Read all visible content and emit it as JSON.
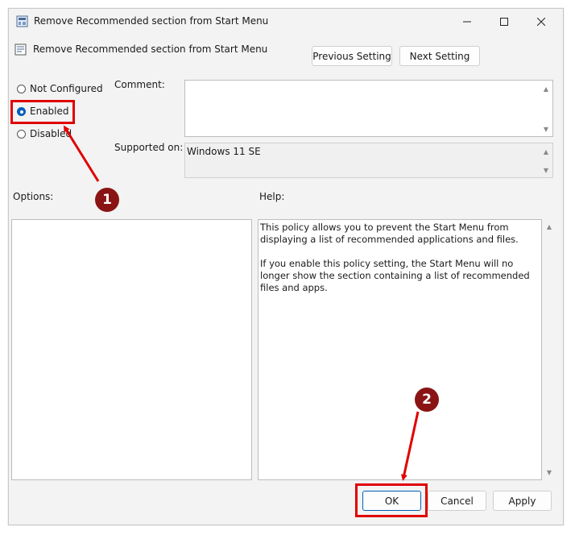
{
  "window": {
    "title": "Remove Recommended section from Start Menu"
  },
  "header": {
    "title": "Remove Recommended section from Start Menu",
    "previous_label": "Previous Setting",
    "next_label": "Next Setting"
  },
  "state": {
    "options": [
      {
        "label": "Not Configured",
        "selected": false
      },
      {
        "label": "Enabled",
        "selected": true
      },
      {
        "label": "Disabled",
        "selected": false
      }
    ]
  },
  "comment": {
    "label": "Comment:",
    "value": ""
  },
  "supported": {
    "label": "Supported on:",
    "value": "Windows 11 SE"
  },
  "options_panel": {
    "label": "Options:"
  },
  "help_panel": {
    "label": "Help:",
    "paragraphs": [
      "This policy allows you to prevent the Start Menu from displaying a list of recommended applications and files.",
      "If you enable this policy setting, the Start Menu will no longer show the section containing a list of recommended files and apps."
    ]
  },
  "footer": {
    "ok_label": "OK",
    "cancel_label": "Cancel",
    "apply_label": "Apply"
  },
  "annotations": {
    "step1": "1",
    "step2": "2",
    "highlight_color": "#e00000",
    "badge_color": "#8a1414"
  }
}
